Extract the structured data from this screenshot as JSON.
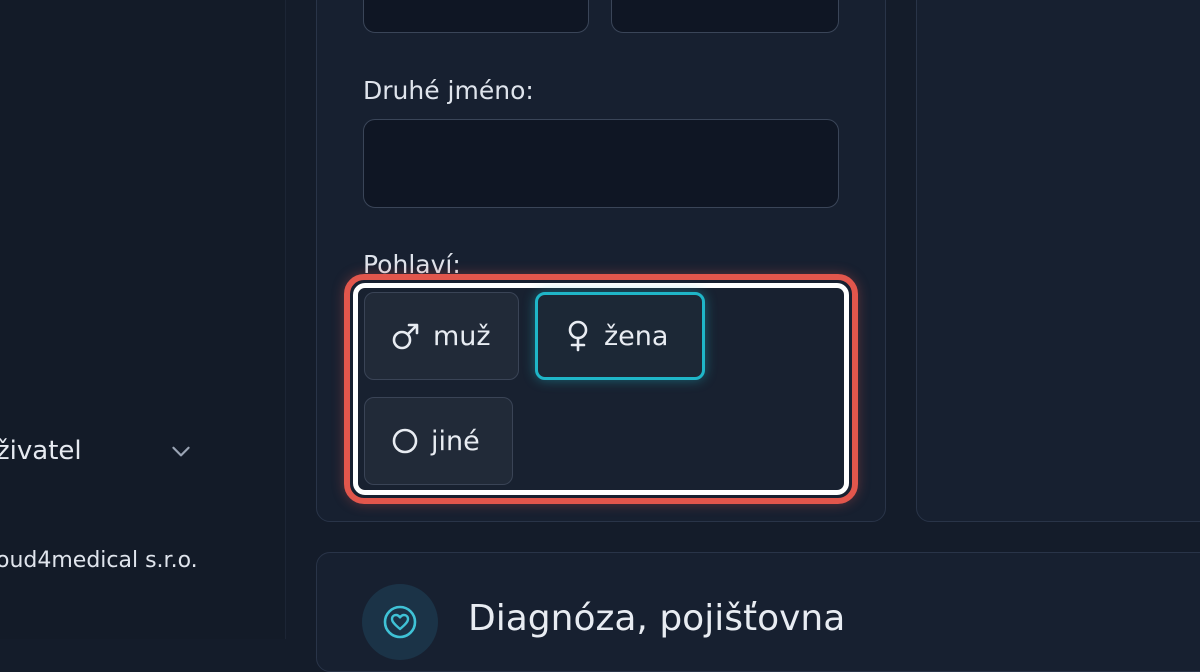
{
  "sidebar": {
    "user_label": "živatel",
    "company": "oud4medical s.r.o."
  },
  "form": {
    "middle_name_label": "Druhé jméno:",
    "middle_name_value": "",
    "gender_label": "Pohlaví:",
    "gender_options": [
      {
        "label": "muž",
        "icon": "male-symbol-icon",
        "selected": false
      },
      {
        "label": "žena",
        "icon": "female-symbol-icon",
        "selected": true
      },
      {
        "label": "jiné",
        "icon": "circle-icon",
        "selected": false
      }
    ]
  },
  "diagnosis_section": {
    "title": "Diagnóza, pojišťovna",
    "icon": "heart-icon"
  },
  "colors": {
    "accent": "#1fb6c8",
    "highlight": "#e2564c"
  }
}
